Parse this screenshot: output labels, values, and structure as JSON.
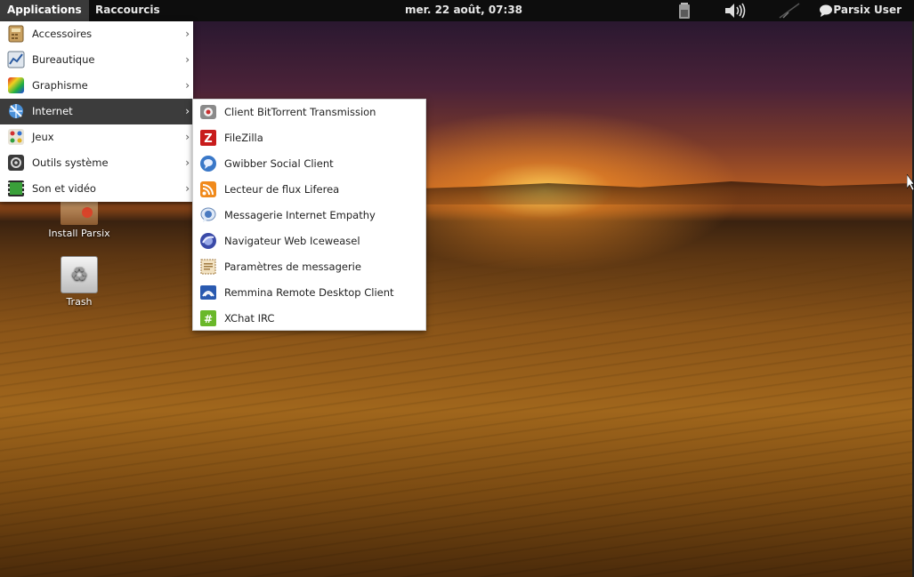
{
  "panel": {
    "applications_label": "Applications",
    "shortcuts_label": "Raccourcis",
    "clock": "mer. 22 août, 07:38",
    "user": "Parsix User",
    "tray_icons": [
      "battery-icon",
      "volume-icon",
      "network-icon",
      "chat-status-icon"
    ]
  },
  "apps_menu": {
    "items": [
      {
        "label": "Accessoires",
        "icon": "accessories-icon",
        "arrow": "›"
      },
      {
        "label": "Bureautique",
        "icon": "office-icon",
        "arrow": "›"
      },
      {
        "label": "Graphisme",
        "icon": "graphics-icon",
        "arrow": "›"
      },
      {
        "label": "Internet",
        "icon": "internet-icon",
        "arrow": "›",
        "active": true
      },
      {
        "label": "Jeux",
        "icon": "games-icon",
        "arrow": "›"
      },
      {
        "label": "Outils système",
        "icon": "system-tools-icon",
        "arrow": "›"
      },
      {
        "label": "Son et vidéo",
        "icon": "sound-video-icon",
        "arrow": "›"
      }
    ]
  },
  "internet_menu": {
    "items": [
      {
        "label": "Client BitTorrent Transmission",
        "icon": "transmission-icon"
      },
      {
        "label": "FileZilla",
        "icon": "filezilla-icon"
      },
      {
        "label": "Gwibber Social Client",
        "icon": "gwibber-icon"
      },
      {
        "label": "Lecteur de flux Liferea",
        "icon": "rss-feed-icon"
      },
      {
        "label": "Messagerie Internet Empathy",
        "icon": "empathy-icon"
      },
      {
        "label": "Navigateur Web Iceweasel",
        "icon": "iceweasel-icon"
      },
      {
        "label": "Paramètres de messagerie",
        "icon": "mail-settings-icon"
      },
      {
        "label": "Remmina Remote Desktop Client",
        "icon": "remmina-icon"
      },
      {
        "label": "XChat IRC",
        "icon": "xchat-icon"
      }
    ]
  },
  "desktop_icons": {
    "install": "Install Parsix",
    "trash": "Trash"
  },
  "colors": {
    "panel_bg": "#0d0d0d",
    "menu_active_bg": "#3c3c3c",
    "menu_bg": "#ffffff"
  }
}
